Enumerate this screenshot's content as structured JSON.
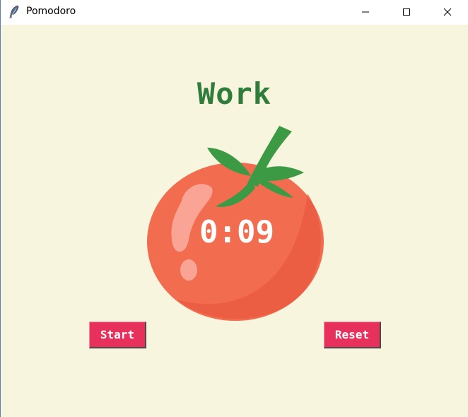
{
  "window": {
    "title": "Pomodoro",
    "icon": "feather-icon",
    "controls": [
      "minimize-icon",
      "maximize-icon",
      "close-icon"
    ]
  },
  "main": {
    "mode_label": "Work",
    "timer": "0:09",
    "start_label": "Start",
    "reset_label": "Reset"
  },
  "colors": {
    "background": "#f7f5dd",
    "title_green": "#2f7d3b",
    "button_red": "#e7305b",
    "tomato": "#f26c4f",
    "leaf": "#3c9a45"
  }
}
